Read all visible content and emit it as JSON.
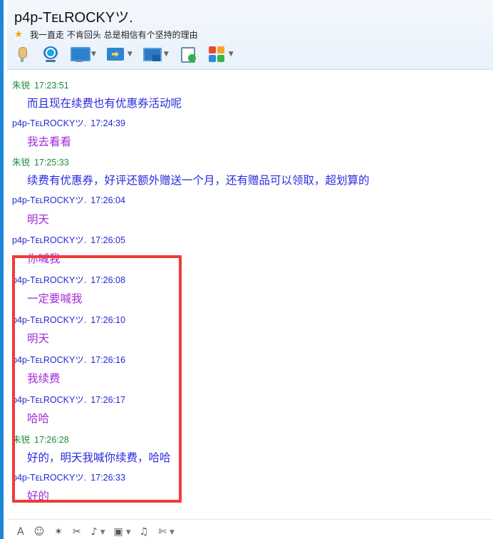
{
  "header": {
    "title": "p4p-TᴇʟROCKYツ.",
    "signature": "我一直走 不肯回头 总是相信有个坚持的理由"
  },
  "toolbar": {
    "items": [
      {
        "icon": "microphone-icon",
        "has_dropdown": false
      },
      {
        "icon": "webcam-icon",
        "has_dropdown": false
      },
      {
        "icon": "screen-share-icon",
        "has_dropdown": true
      },
      {
        "icon": "file-transfer-icon",
        "has_dropdown": true
      },
      {
        "icon": "remote-desktop-icon",
        "has_dropdown": true
      },
      {
        "icon": "create-note-icon",
        "has_dropdown": false
      },
      {
        "icon": "apps-icon",
        "has_dropdown": true
      }
    ]
  },
  "messages": [
    {
      "sender": "朱锐",
      "time": "17:23:51",
      "text": "而且现在续费也有优惠券活动呢",
      "self": false
    },
    {
      "sender": "p4p-TᴇʟROCKYツ.",
      "time": "17:24:39",
      "text": "我去看看",
      "self": true
    },
    {
      "sender": "朱锐",
      "time": "17:25:33",
      "text": "续费有优惠券，好评还额外赠送一个月，还有赠品可以领取，超划算的",
      "self": false
    },
    {
      "sender": "p4p-TᴇʟROCKYツ.",
      "time": "17:26:04",
      "text": "明天",
      "self": true
    },
    {
      "sender": "p4p-TᴇʟROCKYツ.",
      "time": "17:26:05",
      "text": "你喊我",
      "self": true
    },
    {
      "sender": "p4p-TᴇʟROCKYツ.",
      "time": "17:26:08",
      "text": "一定要喊我",
      "self": true
    },
    {
      "sender": "p4p-TᴇʟROCKYツ.",
      "time": "17:26:10",
      "text": "明天",
      "self": true
    },
    {
      "sender": "p4p-TᴇʟROCKYツ.",
      "time": "17:26:16",
      "text": "我续费",
      "self": true
    },
    {
      "sender": "p4p-TᴇʟROCKYツ.",
      "time": "17:26:17",
      "text": "哈哈",
      "self": true
    },
    {
      "sender": "朱锐",
      "time": "17:26:28",
      "text": "好的，明天我喊你续费，哈哈",
      "self": false
    },
    {
      "sender": "p4p-TᴇʟROCKYツ.",
      "time": "17:26:33",
      "text": "好的",
      "self": true
    }
  ],
  "colors": {
    "accent_bar": "#1e88d8",
    "other_name": "#1e8a3b",
    "self_name": "#2727d8",
    "other_text": "#2a2ae0",
    "self_text": "#a32bd9",
    "highlight_box": "#f03a3a"
  },
  "input_toolbar": {
    "items": [
      "font-icon",
      "emoji-icon",
      "nudge-icon",
      "screenshot-icon",
      "voice-message-icon",
      "image-icon",
      "music-icon",
      "scissors-icon"
    ]
  }
}
